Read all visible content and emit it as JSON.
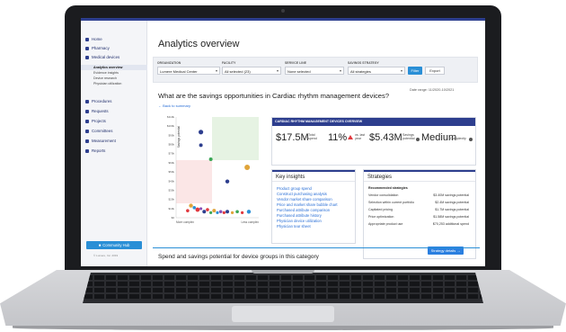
{
  "sidebar": {
    "items": [
      {
        "label": "Home"
      },
      {
        "label": "Pharmacy"
      },
      {
        "label": "Medical devices"
      }
    ],
    "subitems": [
      {
        "label": "Analytics overview"
      },
      {
        "label": "Evidence insights"
      },
      {
        "label": "Device research"
      },
      {
        "label": "Physician utilization"
      }
    ],
    "items2": [
      {
        "label": "Procedures"
      },
      {
        "label": "Requests"
      },
      {
        "label": "Projects"
      },
      {
        "label": "Committees"
      },
      {
        "label": "Measurement"
      },
      {
        "label": "Reports"
      }
    ],
    "community_hub_label": "Community Hub",
    "copyright": "© Lumere, Inc. 2019"
  },
  "page": {
    "title": "Analytics overview"
  },
  "filters": {
    "organization": {
      "label": "ORGANIZATION",
      "value": "Lumere Medical Center"
    },
    "facility": {
      "label": "FACILITY",
      "value": "All selected (23)"
    },
    "service_line": {
      "label": "SERVICE LINE",
      "value": "None selected"
    },
    "savings_strategy": {
      "label": "SAVINGS STRATEGY",
      "value": "All strategies"
    },
    "filter_label": "Filter",
    "export_label": "Export"
  },
  "summary": {
    "question": "What are the savings opportunities in Cardiac rhythm management devices?",
    "date_range": "Date range: 11/2020-10/2021",
    "back_label": "← Back to summary"
  },
  "overview": {
    "header": "CARDIAC RHYTHM MANAGEMENT DEVICES OVERVIEW",
    "total_spend_value": "$17.5M",
    "total_spend_label_1": "Total",
    "total_spend_label_2": "spend",
    "pct_value": "11%",
    "pct_label_1": "vs. last",
    "pct_label_2": "year",
    "savings_value": "$5.43M",
    "savings_label_1": "Savings",
    "savings_label_2": "potential",
    "complexity_value": "Medium",
    "complexity_label": "Complexity"
  },
  "key_insights": {
    "title": "Key insights",
    "links": [
      "Product group spend",
      "Construct purchasing analysis",
      "Vendor market share comparison",
      "Price and market share bubble chart",
      "Purchased attribute comparison",
      "Purchased attribute history",
      "Physician device utilization",
      "Physician tear sheet"
    ]
  },
  "strategies": {
    "title": "Strategies",
    "recommended_label": "Recommended strategies",
    "rows": [
      {
        "name": "Vendor consolidation",
        "value": "$3.40M savings potential"
      },
      {
        "name": "Selection within current portfolio",
        "value": "$2.4M savings potential"
      },
      {
        "name": "Capitated pricing",
        "value": "$1.7M savings potential"
      },
      {
        "name": "Price optimization",
        "value": "$1.58M savings potential"
      },
      {
        "name": "Appropriate product use",
        "value": "$70,253 additional spend"
      }
    ],
    "details_label": "Strategy details →"
  },
  "bottom": {
    "title": "Spend and savings potential for device groups in this category"
  },
  "scatter": {
    "y_ticks": [
      "$110k",
      "$100k",
      "$90k",
      "$80k",
      "$70k",
      "$60k",
      "$50k",
      "$40k",
      "$30k",
      "$20k",
      "$10k",
      "$0"
    ],
    "y_label": "Savings potential",
    "x_left_label": "More complex",
    "x_right_label": "Less complex",
    "points": [
      {
        "x": 0.3,
        "y": 0.85,
        "r": 2.6,
        "color": "#2d3e8e"
      },
      {
        "x": 0.3,
        "y": 0.72,
        "r": 2.0,
        "color": "#2d3e8e"
      },
      {
        "x": 0.42,
        "y": 0.58,
        "r": 2.0,
        "color": "#3aa655"
      },
      {
        "x": 0.86,
        "y": 0.5,
        "r": 3.0,
        "color": "#e0a43a"
      },
      {
        "x": 0.62,
        "y": 0.36,
        "r": 2.2,
        "color": "#2d3e8e"
      },
      {
        "x": 0.18,
        "y": 0.12,
        "r": 2.2,
        "color": "#e0a43a"
      },
      {
        "x": 0.22,
        "y": 0.1,
        "r": 1.8,
        "color": "#2a8fd6"
      },
      {
        "x": 0.26,
        "y": 0.08,
        "r": 2.4,
        "color": "#e0383e"
      },
      {
        "x": 0.3,
        "y": 0.09,
        "r": 1.6,
        "color": "#8a4fb5"
      },
      {
        "x": 0.34,
        "y": 0.06,
        "r": 2.0,
        "color": "#2d3e8e"
      },
      {
        "x": 0.38,
        "y": 0.08,
        "r": 1.8,
        "color": "#e0383e"
      },
      {
        "x": 0.42,
        "y": 0.05,
        "r": 1.6,
        "color": "#3aa655"
      },
      {
        "x": 0.46,
        "y": 0.07,
        "r": 2.0,
        "color": "#e0a43a"
      },
      {
        "x": 0.5,
        "y": 0.05,
        "r": 1.6,
        "color": "#2a8fd6"
      },
      {
        "x": 0.54,
        "y": 0.06,
        "r": 1.8,
        "color": "#8a4fb5"
      },
      {
        "x": 0.58,
        "y": 0.05,
        "r": 1.6,
        "color": "#e0383e"
      },
      {
        "x": 0.62,
        "y": 0.06,
        "r": 2.0,
        "color": "#2d3e8e"
      },
      {
        "x": 0.68,
        "y": 0.05,
        "r": 1.6,
        "color": "#e0a43a"
      },
      {
        "x": 0.74,
        "y": 0.06,
        "r": 1.8,
        "color": "#3aa655"
      },
      {
        "x": 0.8,
        "y": 0.05,
        "r": 1.6,
        "color": "#e0383e"
      },
      {
        "x": 0.88,
        "y": 0.06,
        "r": 2.2,
        "color": "#2a8fd6"
      },
      {
        "x": 0.14,
        "y": 0.07,
        "r": 1.8,
        "color": "#e0383e"
      }
    ]
  }
}
